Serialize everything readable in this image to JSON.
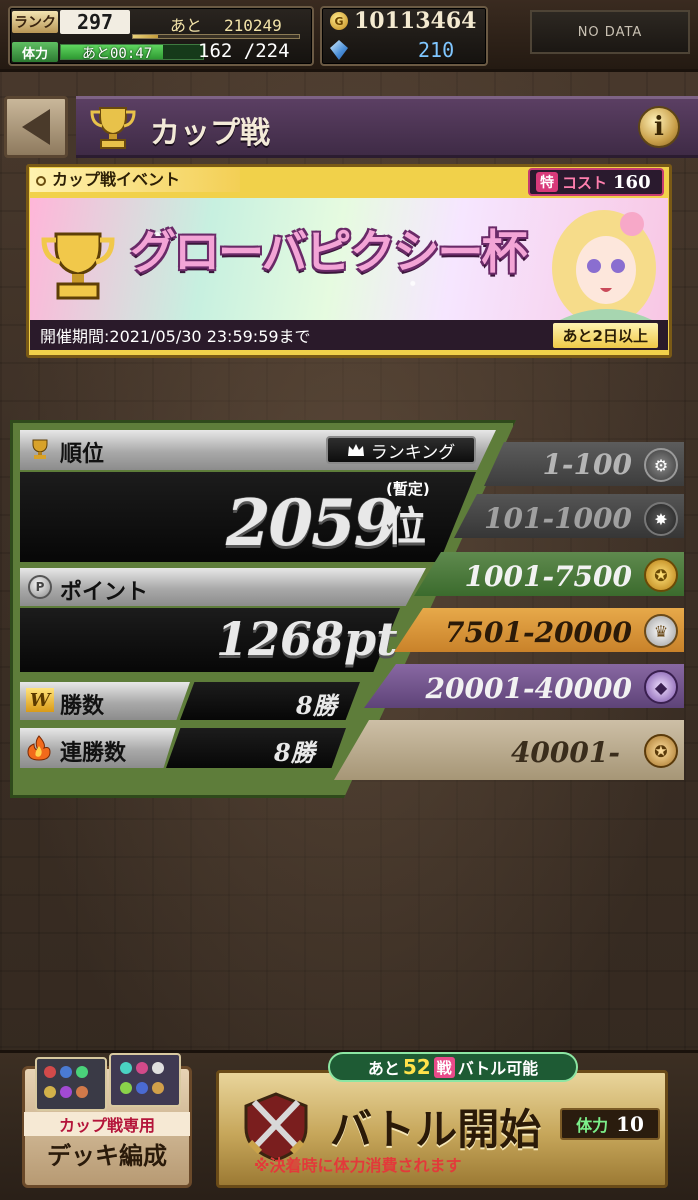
{
  "status_bar": {
    "rank_label": "ランク",
    "rank_value": "297",
    "exp_remaining_label": "あと",
    "exp_remaining_value": "210249",
    "stamina_label": "体力",
    "stamina_timer": "あと00:47",
    "stamina_value": "162 /224",
    "stamina_fraction": 0.72,
    "exp_fraction": 0.15,
    "coins": "10113464",
    "gems": "210",
    "profile_placeholder": "NO DATA"
  },
  "header": {
    "title": "カップ戦",
    "info_label": "i"
  },
  "event": {
    "tag": "カップ戦イベント",
    "cost_badge_mark": "特",
    "cost_label": "コスト",
    "cost_value": "160",
    "title": "グローバピクシー杯",
    "period": "開催期間:2021/05/30 23:59:59まで",
    "remaining": "あと2日以上"
  },
  "stats": {
    "rank_label": "順位",
    "ranking_button": "ランキング",
    "rank_value": "2059",
    "rank_suffix": "位",
    "rank_provisional": "(暫定)",
    "point_label": "ポイント",
    "point_icon": "P",
    "point_value": "1268pt",
    "wins_icon": "W",
    "wins_label": "勝数",
    "wins_value": "8勝",
    "streak_label": "連勝数",
    "streak_value": "8勝"
  },
  "tiers": [
    {
      "range": "1-100",
      "color": "#5c5c5c",
      "text_color": "#b5b5b5",
      "icon": "gear-medal-icon"
    },
    {
      "range": "101-1000",
      "color": "#3d3d3d",
      "text_color": "#a0a0a0",
      "icon": "dark-medal-icon"
    },
    {
      "range": "1001-7500",
      "color": "#4e7a3d",
      "text_color": "#f2f2f2",
      "icon": "gold-medal-icon"
    },
    {
      "range": "7501-20000",
      "color": "#e0a03f",
      "text_color": "#2b1a08",
      "icon": "shield-medal-icon"
    },
    {
      "range": "20001-40000",
      "color": "#735494",
      "text_color": "#f2f2f2",
      "icon": "purple-medal-icon"
    },
    {
      "range": "40001-",
      "color": "#bfae90",
      "text_color": "#3a2d1c",
      "icon": "bronze-medal-icon"
    }
  ],
  "bottom": {
    "deck_line1": "カップ戦専用",
    "deck_line2": "デッキ編成",
    "battle_prefix": "あと",
    "battle_count": "52",
    "battle_unit": "戦",
    "battle_suffix": "バトル可能",
    "battle_title": "バトル開始",
    "battle_cost_label": "体力",
    "battle_cost_value": "10",
    "battle_note": "※決着時に体力消費されます"
  }
}
